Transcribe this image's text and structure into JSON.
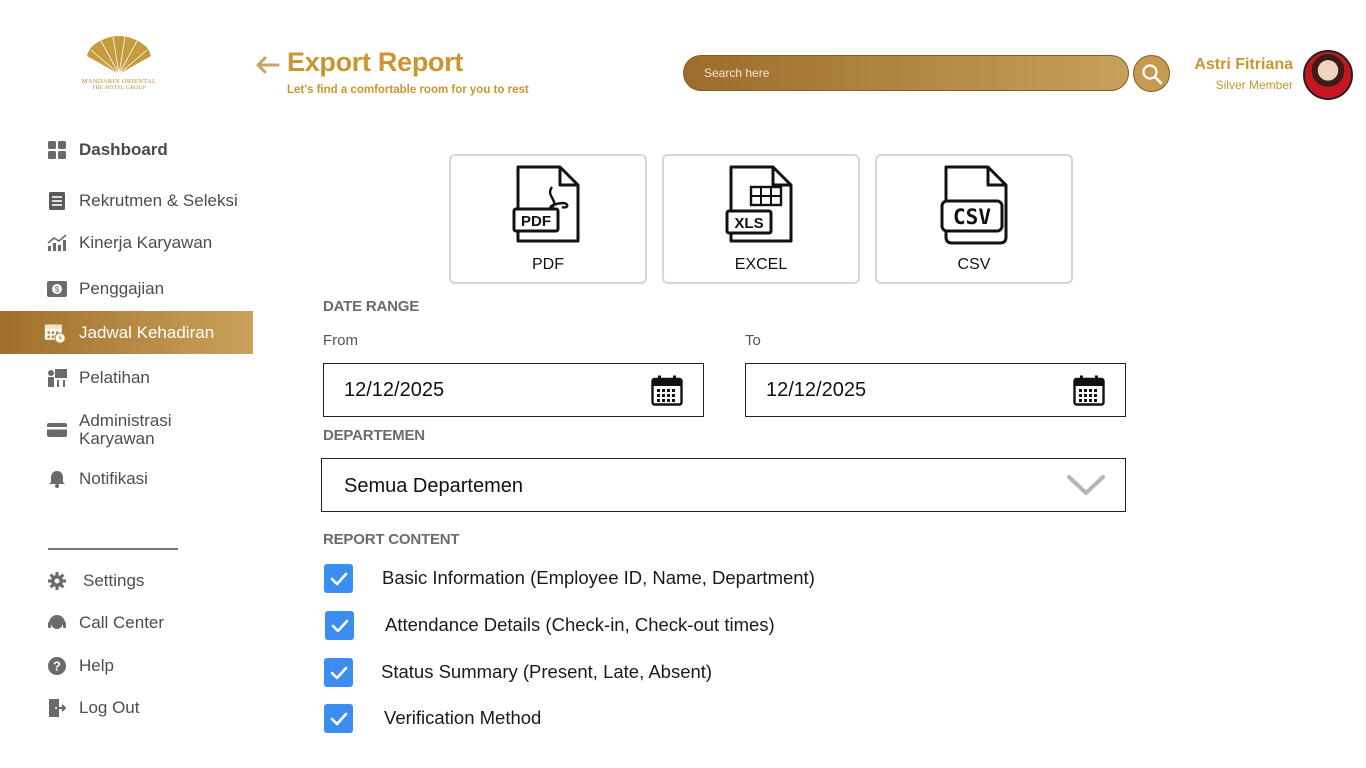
{
  "brand": {
    "line1": "MANDARIN ORIENTAL",
    "line2": "THE HOTEL GROUP",
    "color": "#c49a3a"
  },
  "header": {
    "title": "Export Report",
    "subtitle": "Let's find a comfortable room for you to rest",
    "search_placeholder": "Search here"
  },
  "user": {
    "name": "Astri Fitriana",
    "role": "Silver Member"
  },
  "sidebar": {
    "items": [
      {
        "label": "Dashboard",
        "icon": "dashboard-grid-icon"
      },
      {
        "label": "Rekrutmen & Seleksi",
        "icon": "document-list-icon"
      },
      {
        "label": "Kinerja Karyawan",
        "icon": "chart-trend-icon"
      },
      {
        "label": "Penggajian",
        "icon": "payroll-icon"
      },
      {
        "label": "Jadwal Kehadiran",
        "icon": "calendar-clock-icon",
        "active": true
      },
      {
        "label": "Pelatihan",
        "icon": "training-icon"
      },
      {
        "label": "Administrasi Karyawan",
        "icon": "id-card-icon"
      },
      {
        "label": "Notifikasi",
        "icon": "bell-icon"
      }
    ],
    "bottom_items": [
      {
        "label": "Settings",
        "icon": "gear-icon"
      },
      {
        "label": "Call Center",
        "icon": "headset-icon"
      },
      {
        "label": "Help",
        "icon": "help-icon"
      },
      {
        "label": "Log Out",
        "icon": "logout-icon"
      }
    ]
  },
  "formats": [
    {
      "label": "PDF",
      "icon": "pdf-file-icon"
    },
    {
      "label": "EXCEL",
      "icon": "xls-file-icon"
    },
    {
      "label": "CSV",
      "icon": "csv-file-icon"
    }
  ],
  "date_range": {
    "section_label": "DATE RANGE",
    "from_label": "From",
    "from_value": "12/12/2025",
    "to_label": "To",
    "to_value": "12/12/2025"
  },
  "department": {
    "section_label": "DEPARTEMEN",
    "selected": "Semua Departemen"
  },
  "report_content": {
    "section_label": "REPORT CONTENT",
    "options": [
      {
        "label": "Basic Information (Employee ID, Name, Department)",
        "checked": true
      },
      {
        "label": "Attendance Details (Check-in, Check-out times)",
        "checked": true
      },
      {
        "label": "Status Summary (Present, Late, Absent)",
        "checked": true
      },
      {
        "label": "Verification Method",
        "checked": true
      }
    ]
  },
  "colors": {
    "accent_gold": "#c9962f",
    "active_gradient_start": "#a06f2b",
    "active_gradient_end": "#c9a15b",
    "checkbox_blue": "#3b8ef0"
  }
}
